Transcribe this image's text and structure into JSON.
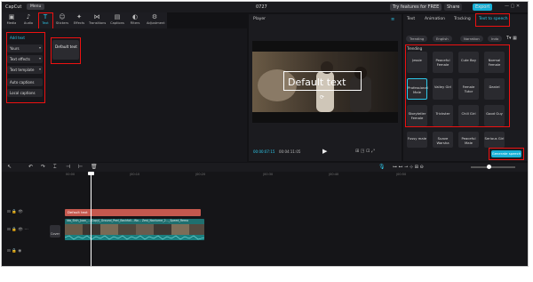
{
  "titlebar": {
    "app": "CapCut",
    "menu": "Menu",
    "title": "0727",
    "promo": "Try features for FREE",
    "share": "Share",
    "export": "Export"
  },
  "toolbar": [
    "Media",
    "Audio",
    "Text",
    "Stickers",
    "Effects",
    "Transitions",
    "Captions",
    "Filters",
    "Adjustment"
  ],
  "sidebar": [
    "Add text",
    "Yours",
    "Text effects",
    "Text template",
    "Auto captions",
    "Local captions"
  ],
  "default_text_card": "Default text",
  "player": {
    "label": "Player",
    "overlay_text": "Default text",
    "time_current": "00:00:07:15",
    "time_total": "00:04:11:05"
  },
  "right_panel": {
    "tabs": [
      "Text",
      "Animation",
      "Tracking",
      "Text to speech"
    ],
    "chips": [
      "Trending",
      "English",
      "Narration",
      "Indo"
    ],
    "section": "Trending",
    "voices": [
      "Jessie",
      "Peaceful Female",
      "Cute Boy",
      "Normal Female",
      "Professional Male",
      "Valley Girl",
      "Female Tutor",
      "Daniel",
      "Storyteller Female",
      "Trickster",
      "Chill Girl",
      "Good Guy",
      "Fussy male",
      "Suave Warsha",
      "Peaceful Male",
      "Serious Girl"
    ],
    "generate": "Generate speech"
  },
  "timeline": {
    "ruler": [
      "00:00",
      "|00:10",
      "|00:20",
      "|00:30",
      "|00:40",
      "|00:50"
    ],
    "text_clip": "Default text",
    "video_clip": "Ida_Shih_Juan_...(Copy)_Ground_Peel_Backfall...Wo... Zest_Nocturne_2..._Speed_Remo",
    "cover": "Cover"
  }
}
